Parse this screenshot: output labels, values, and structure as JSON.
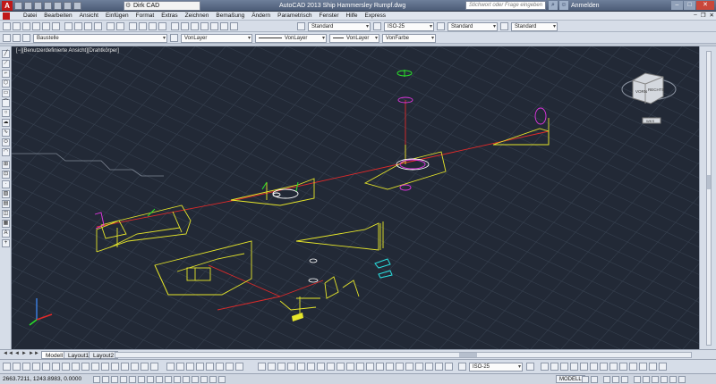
{
  "titlebar": {
    "workspace": "Dirk CAD",
    "window_title": "AutoCAD 2013   Ship Hammersley Rumpf.dwg",
    "search_placeholder": "Stichwort oder Frage eingeben",
    "login": "Anmelden"
  },
  "menu": [
    "Datei",
    "Bearbeiten",
    "Ansicht",
    "Einfügen",
    "Format",
    "Extras",
    "Zeichnen",
    "Bemaßung",
    "Ändern",
    "Parametrisch",
    "Fenster",
    "Hilfe",
    "Express"
  ],
  "toolbar1": {
    "text_style": "Standard",
    "dim_style": "ISO-25",
    "table_style": "Standard",
    "multileader_style": "Standard"
  },
  "toolbar2": {
    "layer": "Baustelle",
    "color": "VonLayer",
    "linetype": "VonLayer",
    "lineweight": "VonLayer",
    "plotstyle": "VonFarbe"
  },
  "viewport": {
    "label": "[−][Benutzerdefinierte Ansicht][Drahtkörper]",
    "viewcube_faces": [
      "VORN",
      "RECHTS"
    ],
    "wcs_label": "WKS"
  },
  "tabs": [
    "Modell",
    "Layout1",
    "Layout2"
  ],
  "bottombar": {
    "dim_style": "ISO-25"
  },
  "status": {
    "coordinates": "2663.7211, 1243.8983, 0.0000",
    "space": "MODELL"
  },
  "colors": {
    "viewport_bg": "#222936",
    "grid": "#36404f",
    "geometry_yellow": "#e6e62a",
    "axis_red": "#e02a2a",
    "magenta": "#e236e2",
    "cyan": "#2ae0e0",
    "green": "#2ae02a"
  }
}
